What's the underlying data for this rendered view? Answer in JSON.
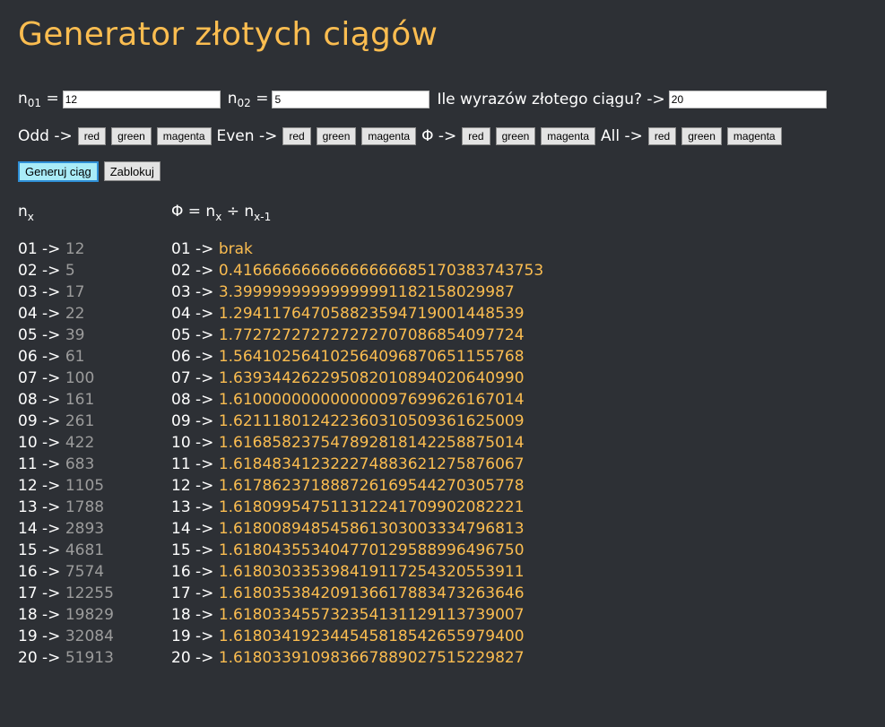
{
  "title": "Generator złotych ciągów",
  "inputs": {
    "n01_label": "n",
    "n01_sub": "01",
    "n01_value": "12",
    "n02_label": "n",
    "n02_sub": "02",
    "n02_value": "5",
    "count_label": "Ile wyrazów złotego ciągu? ->",
    "count_value": "20",
    "eq": "="
  },
  "color_groups": [
    {
      "label": "Odd ->",
      "buttons": [
        "red",
        "green",
        "magenta"
      ]
    },
    {
      "label": "Even ->",
      "buttons": [
        "red",
        "green",
        "magenta"
      ]
    },
    {
      "label": "Φ ->",
      "buttons": [
        "red",
        "green",
        "magenta"
      ]
    },
    {
      "label": "All ->",
      "buttons": [
        "red",
        "green",
        "magenta"
      ]
    }
  ],
  "actions": {
    "generate_label": "Generuj ciąg",
    "lock_label": "Zablokuj"
  },
  "headers": {
    "left_base": "n",
    "left_sub": "x",
    "right_prefix": "Φ = n",
    "right_sub1": "x",
    "right_mid": " ÷ n",
    "right_sub2": "x-1"
  },
  "arrow": " -> ",
  "sequence": [
    {
      "i": "01",
      "n": "12",
      "phi": "brak"
    },
    {
      "i": "02",
      "n": "5",
      "phi": "0.41666666666666666685170383743753"
    },
    {
      "i": "03",
      "n": "17",
      "phi": "3.39999999999999991182158029987"
    },
    {
      "i": "04",
      "n": "22",
      "phi": "1.29411764705882359471900144853​9"
    },
    {
      "i": "05",
      "n": "39",
      "phi": "1.77272727272727270708685409772​4"
    },
    {
      "i": "06",
      "n": "61",
      "phi": "1.56410256410256409687065115576​8"
    },
    {
      "i": "07",
      "n": "100",
      "phi": "1.63934426229508201089402064099​0"
    },
    {
      "i": "08",
      "n": "161",
      "phi": "1.61000000000000009769962616701​4"
    },
    {
      "i": "09",
      "n": "261",
      "phi": "1.62111801242236031050936162500​9"
    },
    {
      "i": "10",
      "n": "422",
      "phi": "1.61685823754789281814225887501​4"
    },
    {
      "i": "11",
      "n": "683",
      "phi": "1.61848341232227488362127587606​7"
    },
    {
      "i": "12",
      "n": "1105",
      "phi": "1.61786237188872616954427030577​8"
    },
    {
      "i": "13",
      "n": "1788",
      "phi": "1.61809954751131224170990208222​1"
    },
    {
      "i": "14",
      "n": "2893",
      "phi": "1.61800894854586130300333479681​3"
    },
    {
      "i": "15",
      "n": "4681",
      "phi": "1.61804355340477012958899649675​0"
    },
    {
      "i": "16",
      "n": "7574",
      "phi": "1.61803033539841911725432055391​1"
    },
    {
      "i": "17",
      "n": "12255",
      "phi": "1.61803538420913661788347326364​6"
    },
    {
      "i": "18",
      "n": "19829",
      "phi": "1.61803345573235413112911373900​7"
    },
    {
      "i": "19",
      "n": "32084",
      "phi": "1.61803419234454581854265597940​0"
    },
    {
      "i": "20",
      "n": "51913",
      "phi": "1.61803391098366788902751522982​7"
    }
  ],
  "colors": {
    "background": "#2d3035",
    "accent": "#fbbd50",
    "muted": "#9c9c9c",
    "text": "#ffffff",
    "primary_button": "#a9ecf8"
  }
}
